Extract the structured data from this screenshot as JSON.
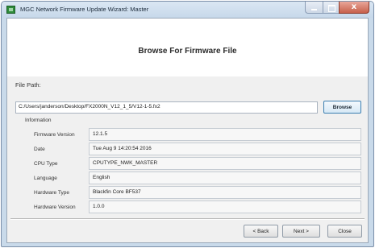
{
  "window": {
    "title": "MGC Network Firmware Update Wizard: Master",
    "close_glyph": "x"
  },
  "header": {
    "title": "Browse For Firmware File"
  },
  "file_path": {
    "label": "File Path:",
    "value": "C:/Users/janderson/Desktop/FX2000N_V12_1_5/V12-1-5.fx2",
    "browse_label": "Browse"
  },
  "information": {
    "heading": "Information",
    "rows": [
      {
        "label": "Firmware Version",
        "value": "12.1.5"
      },
      {
        "label": "Date",
        "value": "Tue Aug 9 14:20:54 2016"
      },
      {
        "label": "CPU Type",
        "value": "CPUTYPE_NWK_MASTER"
      },
      {
        "label": "Language",
        "value": "English"
      },
      {
        "label": "Hardware Type",
        "value": "Blackfin Core BF537"
      },
      {
        "label": "Hardware Version",
        "value": "1.0.0"
      }
    ]
  },
  "footer": {
    "back_label": "< Back",
    "next_label": "Next >",
    "close_label": "Close"
  },
  "colors": {
    "accent_border": "#3c7fb1",
    "app_icon": "#2e8b3a",
    "close_button": "#c7604b"
  }
}
